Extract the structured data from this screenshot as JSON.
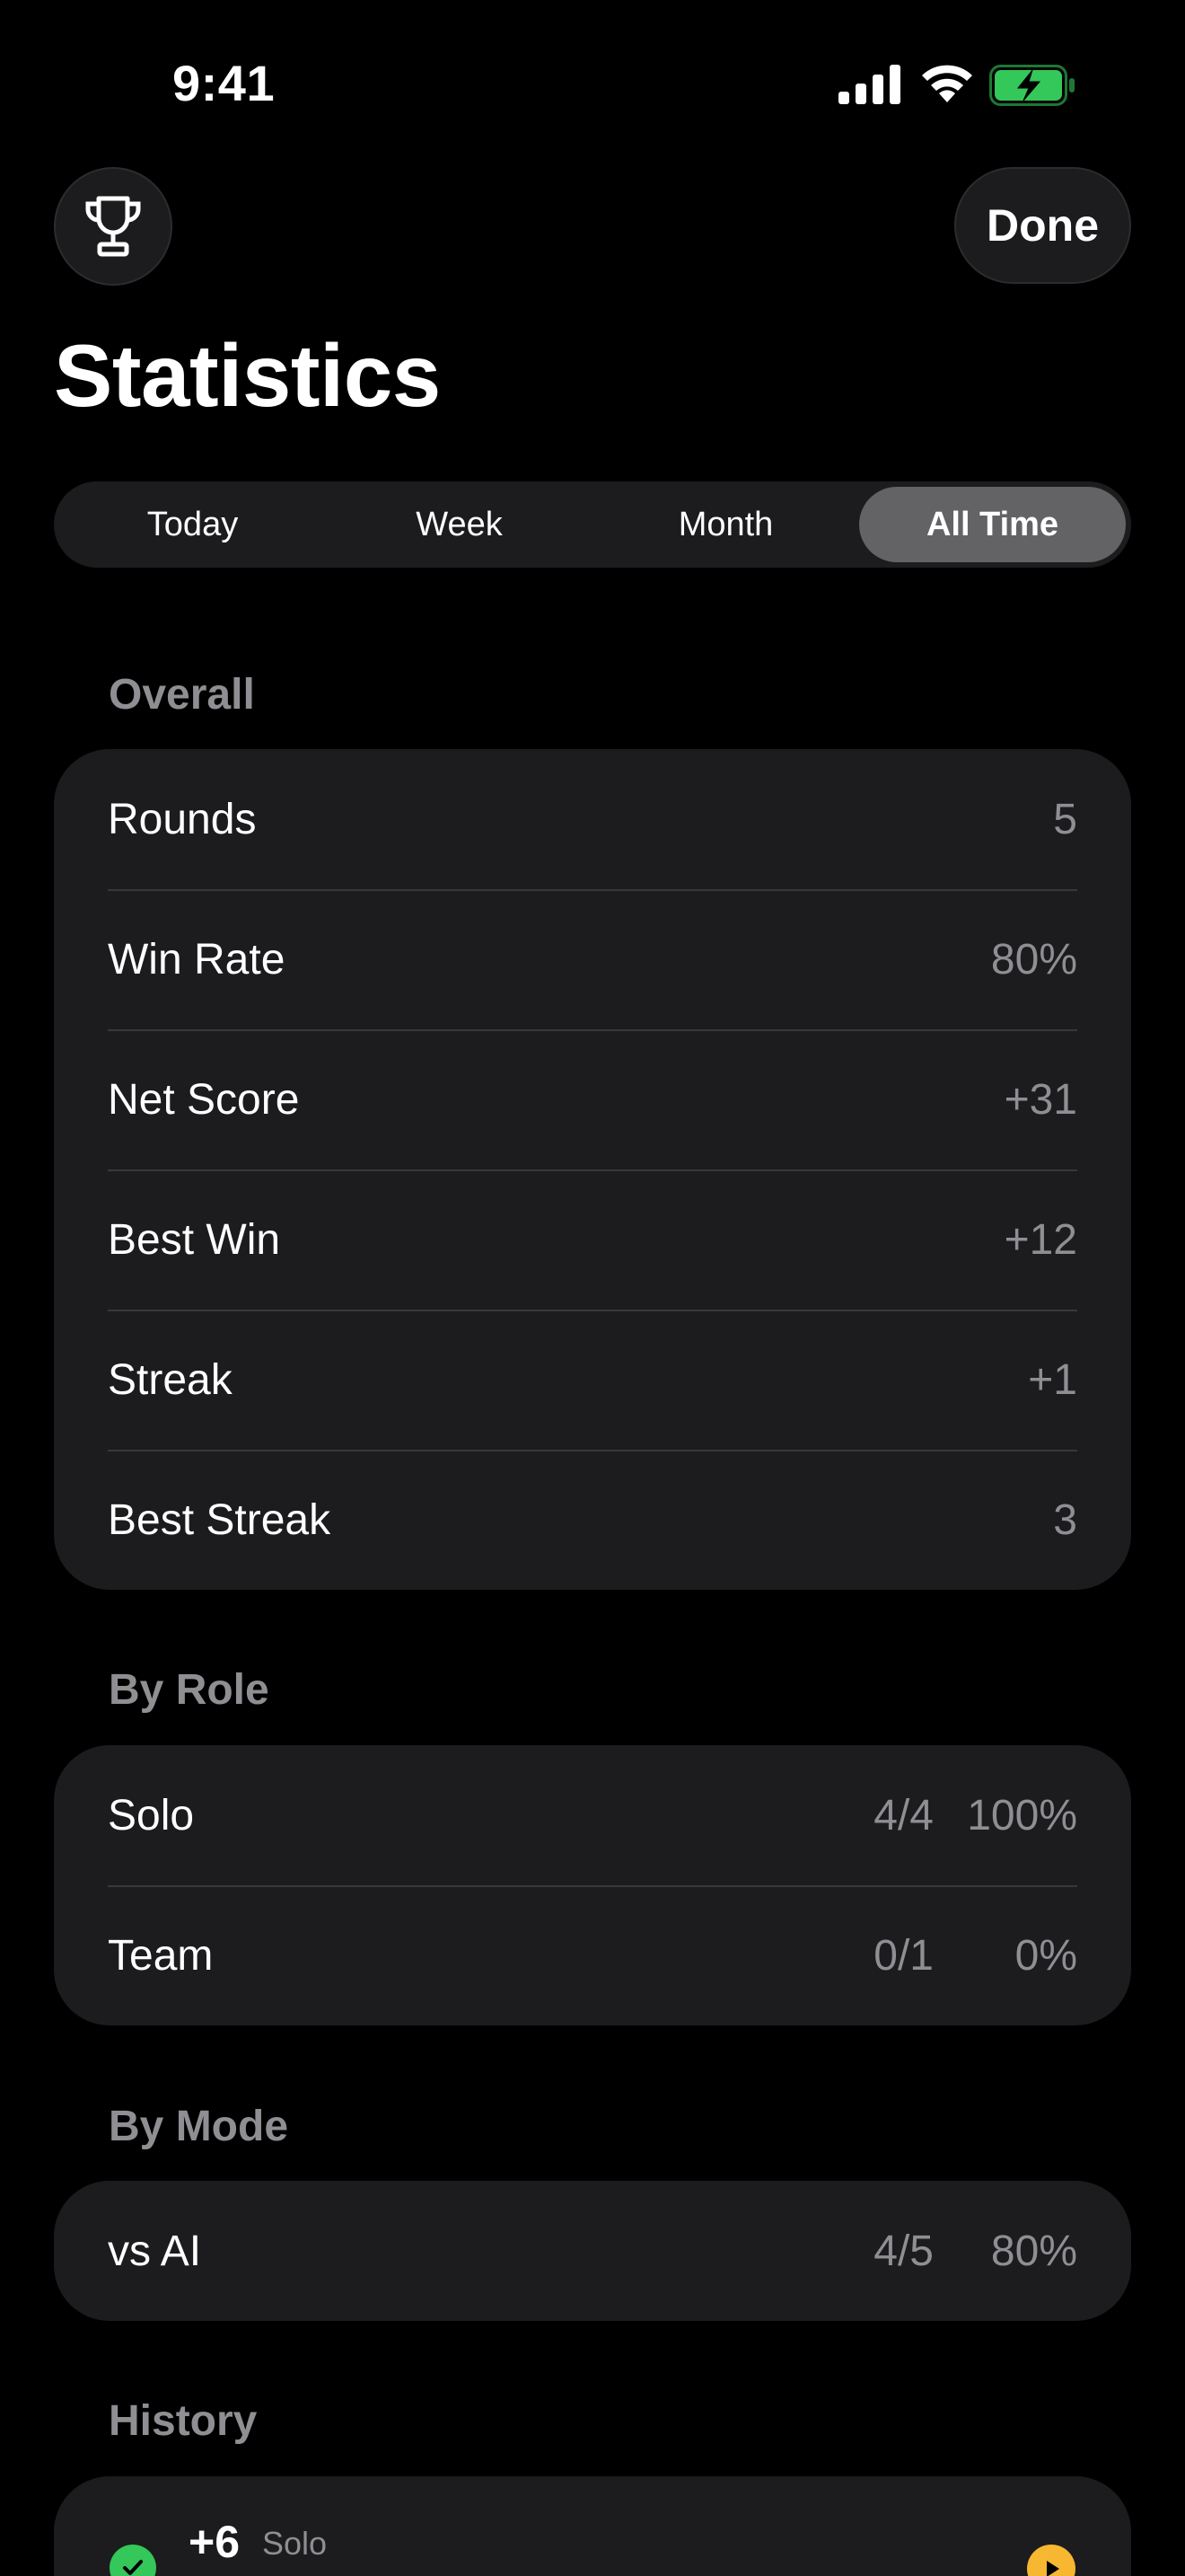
{
  "status_bar": {
    "time": "9:41",
    "icons": [
      "signal-icon",
      "wifi-icon",
      "battery-charging-icon"
    ],
    "battery_color": "#34c759"
  },
  "header": {
    "leading_icon": "trophy-icon",
    "done_label": "Done",
    "title": "Statistics"
  },
  "segments": {
    "items": [
      "Today",
      "Week",
      "Month",
      "All Time"
    ],
    "selected": "All Time"
  },
  "overall": {
    "header": "Overall",
    "rows": [
      {
        "label": "Rounds",
        "value": "5"
      },
      {
        "label": "Win Rate",
        "value": "80%"
      },
      {
        "label": "Net Score",
        "value": "+31"
      },
      {
        "label": "Best Win",
        "value": "+12"
      },
      {
        "label": "Streak",
        "value": "+1"
      },
      {
        "label": "Best Streak",
        "value": "3"
      }
    ]
  },
  "by_role": {
    "header": "By Role",
    "rows": [
      {
        "label": "Solo",
        "record": "4/4",
        "percent": "100%"
      },
      {
        "label": "Team",
        "record": "0/1",
        "percent": "0%"
      }
    ]
  },
  "by_mode": {
    "header": "By Mode",
    "rows": [
      {
        "label": "vs AI",
        "record": "4/5",
        "percent": "80%"
      }
    ]
  },
  "history": {
    "header": "History",
    "items": [
      {
        "score": "+6",
        "role": "Solo",
        "result_icon": "checkmark-circle-icon",
        "action_icon": "play-icon"
      }
    ]
  },
  "colors": {
    "background": "#000000",
    "card": "#1c1c1e",
    "secondary_text": "#8e8e93",
    "selected_segment": "#636366",
    "win": "#34c759",
    "replay": "#f7b731"
  }
}
